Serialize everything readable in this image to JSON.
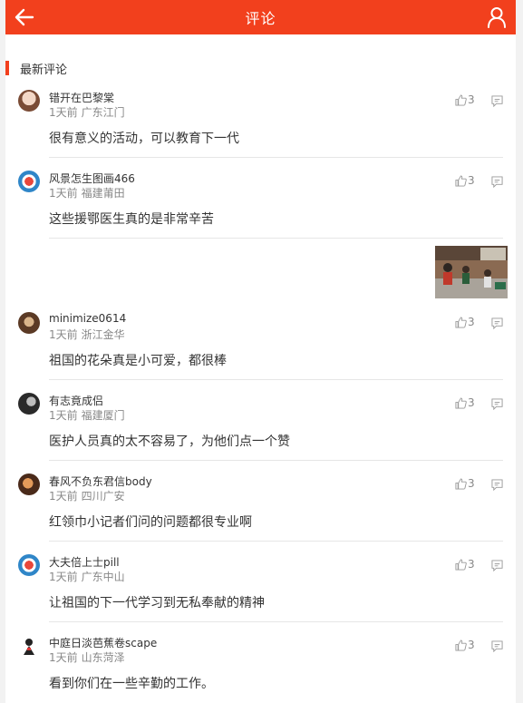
{
  "header": {
    "title": "评论",
    "back_icon": "arrow-left-icon",
    "user_icon": "user-icon"
  },
  "section": {
    "title": "最新评论"
  },
  "comments": [
    {
      "name": "错开在巴黎棠",
      "time": "1天前",
      "location": "广东江门",
      "likes": "3",
      "text": "很有意义的活动，可以教育下一代"
    },
    {
      "name": "风景怎生图画466",
      "time": "1天前",
      "location": "福建莆田",
      "likes": "3",
      "text": "这些援鄂医生真的是非常辛苦"
    },
    {
      "name": "minimize0614",
      "time": "1天前",
      "location": "浙江金华",
      "likes": "3",
      "text": "祖国的花朵真是小可爱，都很棒"
    },
    {
      "name": "有志竟成侣",
      "time": "1天前",
      "location": "福建厦门",
      "likes": "3",
      "text": "医护人员真的太不容易了，为他们点一个赞"
    },
    {
      "name": "春风不负东君信body",
      "time": "1天前",
      "location": "四川广安",
      "likes": "3",
      "text": "红领巾小记者们问的问题都很专业啊"
    },
    {
      "name": "大夫倍上士pill",
      "time": "1天前",
      "location": "广东中山",
      "likes": "3",
      "text": "让祖国的下一代学习到无私奉献的精神"
    },
    {
      "name": "中庭日淡芭蕉卷scape",
      "time": "1天前",
      "location": "山东菏泽",
      "likes": "3",
      "text": "看到你们在一些辛勤的工作。"
    }
  ],
  "colors": {
    "accent": "#f2401d",
    "text": "#333333",
    "muted": "#888888"
  }
}
